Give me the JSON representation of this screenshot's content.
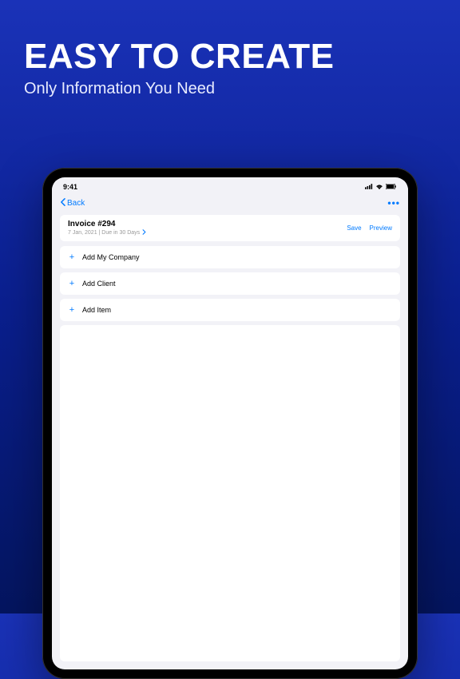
{
  "hero": {
    "title": "EASY TO CREATE",
    "subtitle": "Only Information You Need"
  },
  "statusBar": {
    "time": "9:41"
  },
  "nav": {
    "back": "Back",
    "more": "•••"
  },
  "invoice": {
    "title": "Invoice #294",
    "meta": "7 Jan, 2021 | Due in 30 Days",
    "save": "Save",
    "preview": "Preview"
  },
  "rows": {
    "addCompany": "Add My Company",
    "addClient": "Add Client",
    "addItem": "Add Item"
  }
}
